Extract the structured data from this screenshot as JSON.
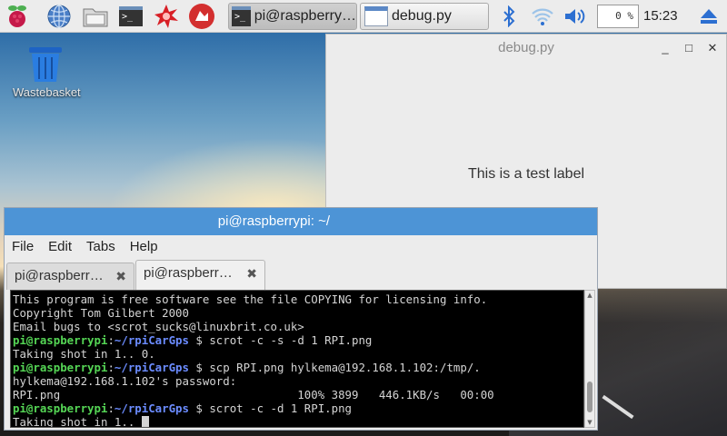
{
  "taskbar": {
    "launchers": [
      {
        "name": "raspberry-menu-icon"
      },
      {
        "name": "web-browser-icon"
      },
      {
        "name": "file-manager-icon"
      },
      {
        "name": "terminal-launcher-icon"
      },
      {
        "name": "mathematica-icon"
      },
      {
        "name": "wolfram-icon"
      }
    ],
    "tasks": [
      {
        "label": "pi@raspberry…",
        "active": true
      },
      {
        "label": "debug.py",
        "active": false
      }
    ],
    "tray": {
      "cpu": "0 %",
      "clock": "15:23"
    }
  },
  "desktop": {
    "wastebasket_label": "Wastebasket"
  },
  "debug_window": {
    "title": "debug.py",
    "label": "This is a test label",
    "controls": {
      "minimize": "_",
      "maximize": "□",
      "close": "✕"
    }
  },
  "terminal_window": {
    "title": "pi@raspberrypi: ~/",
    "menu": [
      "File",
      "Edit",
      "Tabs",
      "Help"
    ],
    "tabs": [
      {
        "label": "pi@raspberr…",
        "close": "✖"
      },
      {
        "label": "pi@raspberr…",
        "close": "✖"
      }
    ],
    "lines": [
      {
        "text": "This program is free software see the file COPYING for licensing info."
      },
      {
        "text": "Copyright Tom Gilbert 2000"
      },
      {
        "text": "Email bugs to <scrot_sucks@linuxbrit.co.uk>"
      },
      {
        "user": "pi@raspberrypi",
        "path": "~/rpiCarGps",
        "cmd": " $ scrot -c -s -d 1 RPI.png"
      },
      {
        "text": "Taking shot in 1.. 0."
      },
      {
        "user": "pi@raspberrypi",
        "path": "~/rpiCarGps",
        "cmd": " $ scp RPI.png hylkema@192.168.1.102:/tmp/."
      },
      {
        "text": "hylkema@192.168.1.102's password:"
      },
      {
        "text": "RPI.png                                   100% 3899   446.1KB/s   00:00"
      },
      {
        "user": "pi@raspberrypi",
        "path": "~/rpiCarGps",
        "cmd": " $ scrot -c -d 1 RPI.png"
      },
      {
        "text": "Taking shot in 1.. ",
        "cursor": true
      }
    ]
  }
}
